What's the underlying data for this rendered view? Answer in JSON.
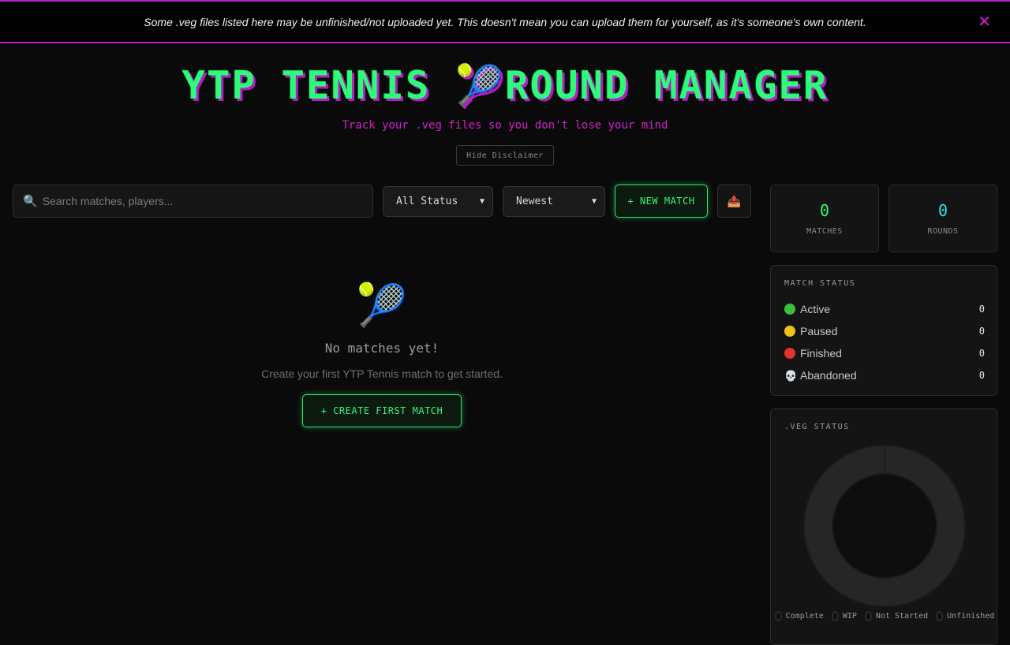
{
  "banner": {
    "text": "Some .veg files listed here may be unfinished/not uploaded yet. This doesn't mean you can upload them for yourself, as it's someone's own content.",
    "close": "✕"
  },
  "header": {
    "title": "YTP TENNIS 🎾ROUND MANAGER",
    "subtitle": "Track your .veg files so you don't lose your mind",
    "hide_disclaimer": "Hide Disclaimer"
  },
  "toolbar": {
    "search_placeholder": "Search matches, players...",
    "status_filter": "All Status",
    "sort": "Newest",
    "new_match": "+ NEW MATCH",
    "export_icon": "📤"
  },
  "empty_state": {
    "icon": "🎾",
    "title": "No matches yet!",
    "subtitle": "Create your first YTP Tennis match to get started.",
    "button": "+ CREATE FIRST MATCH"
  },
  "stats": {
    "matches": {
      "value": "0",
      "label": "MATCHES"
    },
    "rounds": {
      "value": "0",
      "label": "ROUNDS"
    }
  },
  "match_status": {
    "title": "MATCH STATUS",
    "items": [
      {
        "label": "Active",
        "count": "0",
        "color": "#3fbf3f"
      },
      {
        "label": "Paused",
        "count": "0",
        "color": "#f2c21a"
      },
      {
        "label": "Finished",
        "count": "0",
        "color": "#e0342d"
      },
      {
        "label": "Abandoned",
        "count": "0",
        "icon": "💀"
      }
    ]
  },
  "veg_status": {
    "title": ".VEG STATUS",
    "legend": [
      "Complete",
      "WIP",
      "Not Started",
      "Unfinished"
    ]
  },
  "colors": {
    "accent_green": "#2dfc7a",
    "accent_magenta": "#c21cd0",
    "accent_cyan": "#2ae3e8"
  }
}
